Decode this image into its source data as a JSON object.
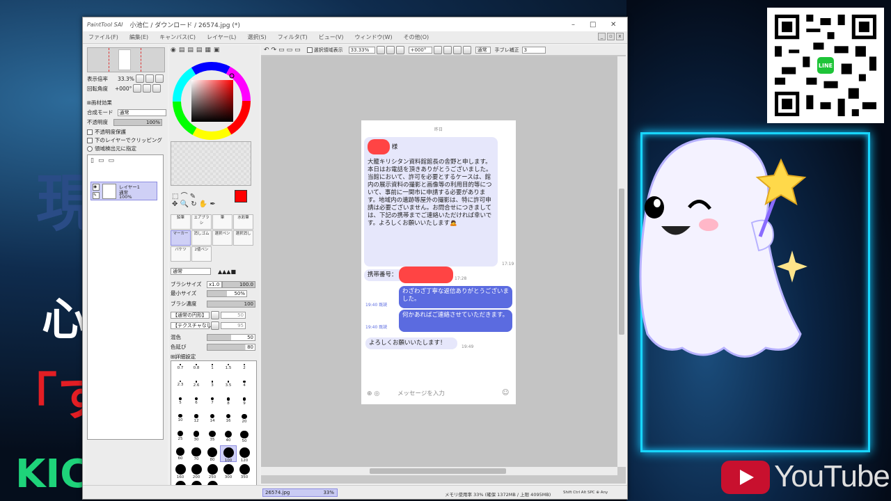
{
  "background": {
    "left_chars": [
      "現",
      "心",
      "「す",
      "KIC"
    ],
    "accent": "#18d6ff",
    "youtube_text": "YouTube",
    "qr_badge": "LINE"
  },
  "window": {
    "app_logo": "PaintTool SAI",
    "title": "小池仁 / ダウンロード / 26574.jpg (*)",
    "controls": [
      "–",
      "□",
      "✕"
    ],
    "menu": [
      "ファイル(F)",
      "編集(E)",
      "キャンバス(C)",
      "レイヤー(L)",
      "選択(S)",
      "フィルタ(T)",
      "ビュー(V)",
      "ウィンドウ(W)",
      "その他(O)"
    ]
  },
  "navigator": {
    "zoom_label": "表示倍率",
    "zoom_value": "33.3%",
    "angle_label": "回転角度",
    "angle_value": "+000°"
  },
  "layer_props": {
    "effects": "画材効果",
    "blend_label": "合成モード",
    "blend_value": "通常",
    "opacity_label": "不透明度",
    "opacity_value": "100%",
    "checks": [
      "不透明度保護",
      "下のレイヤーでクリッピング",
      "領域検出元に指定"
    ],
    "layer_name": "レイヤー1",
    "layer_mode": "通常",
    "layer_opacity": "100%"
  },
  "tools": {
    "items": [
      "鉛筆",
      "エアブラシ",
      "筆",
      "水彩筆",
      "マーカー",
      "消しゴム",
      "選択ペン",
      "選択消し",
      "バケツ",
      "2値ペン"
    ],
    "mode_value": "通常",
    "brush_size_label": "ブラシサイズ",
    "brush_size_mult": "x1.0",
    "brush_size_value": "100.0",
    "min_size_label": "最小サイズ",
    "min_size_value": "50%",
    "density_label": "ブラシ濃度",
    "density_value": "100",
    "shape_value": "【通常の円形】",
    "shape_n": "50",
    "texture_value": "【テクスチャなし】",
    "texture_n": "95",
    "mix_label": "混色",
    "mix_value": "50",
    "blur_label": "色延び",
    "blur_value": "80",
    "detail_label": "詳細設定",
    "brush_sizes": [
      "0.7",
      "0.8",
      "1",
      "1.5",
      "2",
      "2.3",
      "2.6",
      "3",
      "3.5",
      "4",
      "5",
      "6",
      "7",
      "8",
      "9",
      "10",
      "12",
      "14",
      "16",
      "20",
      "25",
      "30",
      "35",
      "40",
      "50",
      "60",
      "70",
      "80",
      "100",
      "120",
      "160",
      "200",
      "250",
      "300",
      "350",
      "400",
      "450",
      "500"
    ],
    "selected_brush_size": "100"
  },
  "canvas_toolbar": {
    "show_selection": "選択領域表示",
    "zoom": "33.33%",
    "angle": "+000°",
    "mode": "通常",
    "stabilizer_label": "手ブレ補正",
    "stabilizer_value": "3"
  },
  "chat": {
    "day": "昨日",
    "suffix": "様",
    "message1": "大籠キリシタン資料館館長の舎野と申します。本日はお電話を頂きありがとうございました。当館において、許可を必要とするケースは、館内の展示資料の撮影と画像等の利用目的等について、事前に一関市に申請する必要があります。地域内の遺跡等屋外の撮影は、特に許可申請は必要ございません。お問合せにつきましては、下記の携帯までご連絡いただければ幸いです。よろしくお願いいたします🙇",
    "time1": "17:19",
    "message2": "携帯番号：",
    "time2": "17:28",
    "message3": "わざわざ丁寧な返信ありがとうございました。",
    "time3": "19:40",
    "read3": "既読",
    "message4": "何かあればご連絡させていただきます。",
    "time4": "19:40",
    "read4": "既読",
    "message5": "よろしくお願いいたします！",
    "time5": "19:49",
    "input_placeholder": "メッセージを入力"
  },
  "status": {
    "file_tab": "26574.jpg",
    "file_zoom": "33%",
    "memory": "メモリ使用率 33% (確保 1372MB / 上限 4095MB)",
    "keys": "Shift Ctrl Alt SPC ⊕ Any"
  }
}
